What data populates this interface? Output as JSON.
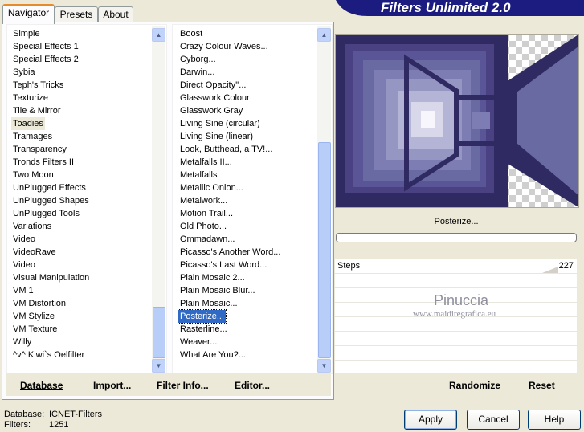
{
  "tabs": [
    "Navigator",
    "Presets",
    "About"
  ],
  "title_banner": "Filters Unlimited 2.0",
  "categories": [
    "Simple",
    "Special Effects 1",
    "Special Effects 2",
    "Sybia",
    "Teph's Tricks",
    "Texturize",
    "Tile & Mirror",
    "Toadies",
    "Tramages",
    "Transparency",
    "Tronds Filters II",
    "Two Moon",
    "UnPlugged Effects",
    "UnPlugged Shapes",
    "UnPlugged Tools",
    "Variations",
    "Video",
    "VideoRave",
    "Video",
    "Visual Manipulation",
    "VM 1",
    "VM Distortion",
    "VM Stylize",
    "VM Texture",
    "Willy",
    "^v^ Kiwi`s Oelfilter"
  ],
  "selected_category": "Toadies",
  "filters": [
    "Boost",
    "Crazy Colour Waves...",
    "Cyborg...",
    "Darwin...",
    "Direct Opacity''...",
    "Glasswork Colour",
    "Glasswork Gray",
    "Living Sine (circular)",
    "Living Sine (linear)",
    "Look, Butthead, a TV!...",
    "Metalfalls II...",
    "Metalfalls",
    "Metallic Onion...",
    "Metalwork...",
    "Motion Trail...",
    "Old Photo...",
    "Ommadawn...",
    "Picasso's Another Word...",
    "Picasso's Last Word...",
    "Plain Mosaic 2...",
    "Plain Mosaic Blur...",
    "Plain Mosaic...",
    "Posterize...",
    "Rasterline...",
    "Weaver...",
    "What Are You?..."
  ],
  "selected_filter": "Posterize...",
  "bottom_links": {
    "database": "Database",
    "import": "Import...",
    "filter_info": "Filter Info...",
    "editor": "Editor..."
  },
  "preview": {
    "filter_name": "Posterize..."
  },
  "param": {
    "label": "Steps",
    "value": "227"
  },
  "watermark": {
    "name": "Pinuccia",
    "url": "www.maidiregrafica.eu"
  },
  "right_buttons": {
    "randomize": "Randomize",
    "reset": "Reset"
  },
  "status": {
    "db_label": "Database:",
    "db_value": "ICNET-Filters",
    "filters_label": "Filters:",
    "filters_value": "1251"
  },
  "dialog_buttons": {
    "apply": "Apply",
    "cancel": "Cancel",
    "help": "Help"
  },
  "colors": {
    "banner": "#1c1c80",
    "preview_dark": "#2f2a62",
    "selection": "#316ac5"
  }
}
